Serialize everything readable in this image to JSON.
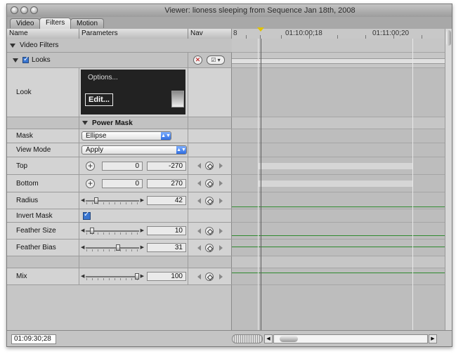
{
  "window": {
    "title": "Viewer: lioness sleeping from Sequence Jan 18th, 2008"
  },
  "tabs": [
    {
      "label": "Video"
    },
    {
      "label": "Filters"
    },
    {
      "label": "Motion"
    }
  ],
  "active_tab": "Filters",
  "columns": {
    "name": "Name",
    "params": "Parameters",
    "nav": "Nav"
  },
  "ruler": {
    "labels": [
      "8",
      "01:10:00;18",
      "01:11:00;20"
    ]
  },
  "groups": {
    "video_filters": "Video Filters",
    "looks": "Looks",
    "power_mask": "Power Mask"
  },
  "look": {
    "label": "Look",
    "options": "Options...",
    "edit": "Edit..."
  },
  "params": {
    "mask": {
      "label": "Mask",
      "value": "Ellipse"
    },
    "view_mode": {
      "label": "View Mode",
      "value": "Apply"
    },
    "top": {
      "label": "Top",
      "x": "0",
      "y": "-270"
    },
    "bottom": {
      "label": "Bottom",
      "x": "0",
      "y": "270"
    },
    "radius": {
      "label": "Radius",
      "value": "42",
      "level": 0.17
    },
    "invert_mask": {
      "label": "Invert Mask",
      "checked": true
    },
    "feather_size": {
      "label": "Feather Size",
      "value": "10",
      "level": 0.08
    },
    "feather_bias": {
      "label": "Feather Bias",
      "value": "31",
      "level": 0.62
    },
    "mix": {
      "label": "Mix",
      "value": "100",
      "level": 1.0
    }
  },
  "status": {
    "timecode": "01:09:30;28"
  }
}
